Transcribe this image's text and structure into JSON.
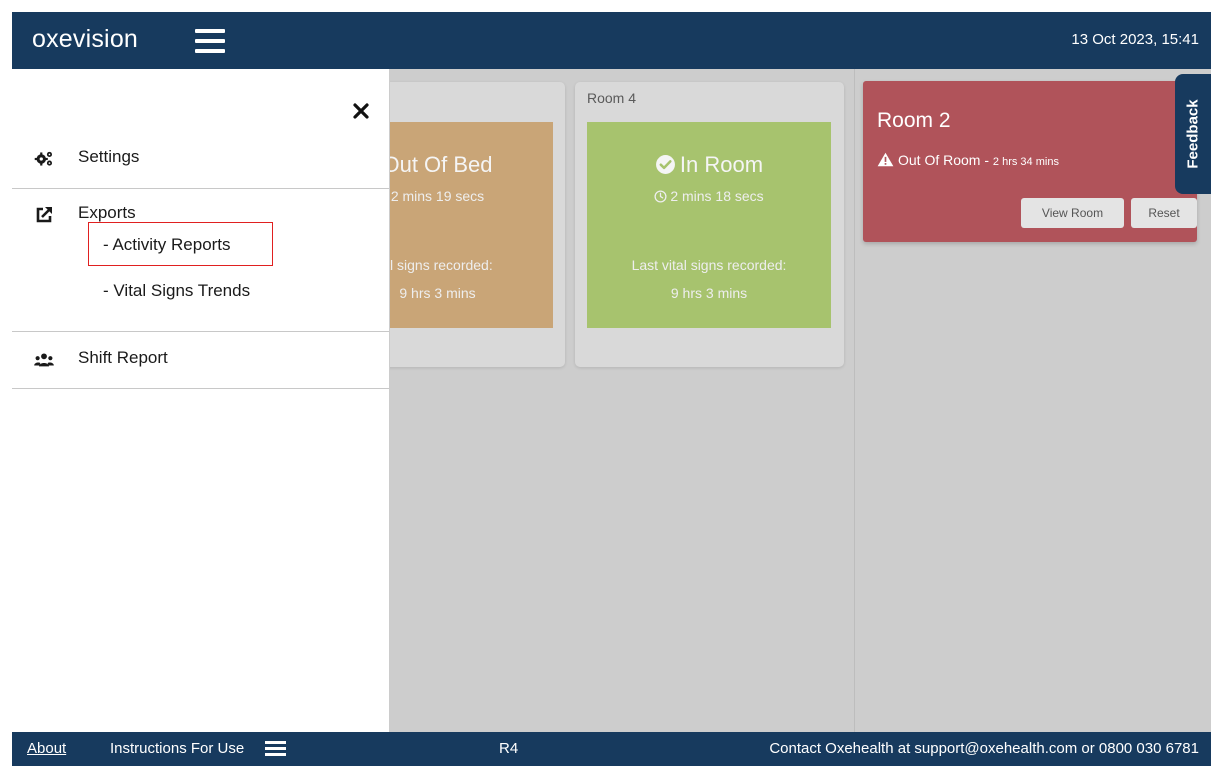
{
  "header": {
    "logo_text": "oxevision",
    "datetime": "13 Oct 2023, 15:41"
  },
  "drawer": {
    "settings_label": "Settings",
    "exports_label": "Exports",
    "exports_items": [
      "- Activity Reports",
      "- Vital Signs Trends"
    ],
    "shift_report_label": "Shift Report"
  },
  "rooms": {
    "card_a": {
      "status": "Out Of Bed",
      "duration": "2 mins 19 secs",
      "vitals_line1": "al signs recorded:",
      "vitals_line2": "9 hrs 3 mins"
    },
    "card_b": {
      "title": "Room 4",
      "status": "In Room",
      "duration": "2 mins 18 secs",
      "vitals_line1": "Last vital signs recorded:",
      "vitals_line2": "9 hrs 3 mins"
    },
    "card_red": {
      "title": "Room 2",
      "status_text": "Out Of Room - ",
      "status_time": "2 hrs 34 mins",
      "view_button": "View Room",
      "reset_button": "Reset"
    }
  },
  "feedback_label": "Feedback",
  "footer": {
    "about": "About",
    "instructions": "Instructions For Use",
    "version": "R4",
    "contact": "Contact Oxehealth at support@oxehealth.com or 0800 030 6781"
  },
  "colors": {
    "header_bg": "#173a5e",
    "alert_red": "#b0535a",
    "in_room_green": "#a7c36e",
    "out_of_bed_orange": "#c9a577",
    "highlight_border": "#e02020"
  },
  "icons": {
    "settings": "gears-icon",
    "exports": "external-link-icon",
    "shift_report": "users-icon",
    "close": "close-icon",
    "menu": "hamburger-icon",
    "in_room": "check-circle-icon",
    "timer": "clock-icon",
    "alert": "warning-triangle-icon"
  }
}
